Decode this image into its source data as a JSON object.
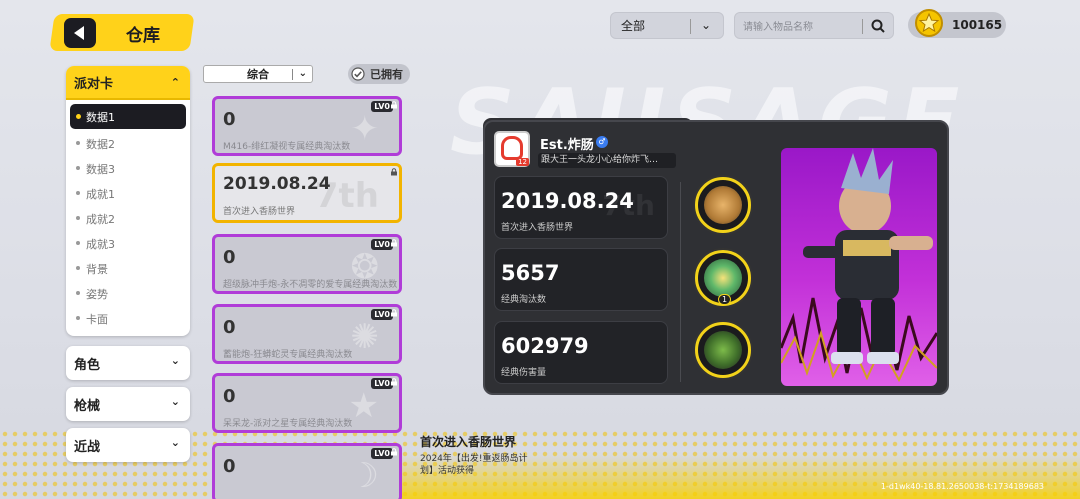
{
  "header": {
    "title": "仓库",
    "filter_value": "全部",
    "search_placeholder": "请输入物品名称",
    "currency": "100165"
  },
  "background": {
    "banner_word": "SAUSAGE"
  },
  "menu": {
    "expanded_label": "派对卡",
    "sub_items": [
      "数据1",
      "数据2",
      "数据3",
      "成就1",
      "成就2",
      "成就3",
      "背景",
      "姿势",
      "卡面"
    ],
    "active_index": 0,
    "collapsed": [
      "角色",
      "枪械",
      "近战"
    ]
  },
  "list_filter": {
    "sort_value": "综合",
    "owned_label": "已拥有"
  },
  "cards": [
    {
      "value": "0",
      "desc": "M416-绯红凝视专属经典淘汰数",
      "level": "LV0",
      "style": "purple"
    },
    {
      "value": "2019.08.24",
      "desc": "首次进入香肠世界",
      "level": "",
      "style": "gold"
    },
    {
      "value": "0",
      "desc": "超级脉冲手炮-永不凋零的爱专属经典淘汰数",
      "level": "LV0",
      "style": "purple"
    },
    {
      "value": "0",
      "desc": "蓄能炮-狂蟒蛇灵专属经典淘汰数",
      "level": "LV0",
      "style": "purple"
    },
    {
      "value": "0",
      "desc": "呆呆龙-派对之星专属经典淘汰数",
      "level": "LV0",
      "style": "purple"
    },
    {
      "value": "0",
      "desc": "",
      "level": "LV0",
      "style": "purple"
    }
  ],
  "profile": {
    "name": "Est.炸肠",
    "avatar_badge": "12",
    "motto": "跟大王一头龙小心给你炸飞…",
    "stats": [
      {
        "value": "2019.08.24",
        "label": "首次进入香肠世界"
      },
      {
        "value": "5657",
        "label": "经典淘汰数"
      },
      {
        "value": "602979",
        "label": "经典伤害量"
      }
    ],
    "medals": [
      {
        "icon": "bread-medal-icon",
        "count": ""
      },
      {
        "icon": "star-medal-icon",
        "count": "1"
      },
      {
        "icon": "plant-medal-icon",
        "count": ""
      }
    ]
  },
  "selected_info": {
    "title": "首次进入香肠世界",
    "desc": "2024年【出发!重返肠岛计划】活动获得"
  },
  "build_string": "1-d1wk40-18.81.2650038-t:1734189683",
  "colors": {
    "accent": "#ffd21a",
    "panel": "#2f3034",
    "card_border": "#b03cd8",
    "gold_border": "#f2b400"
  }
}
